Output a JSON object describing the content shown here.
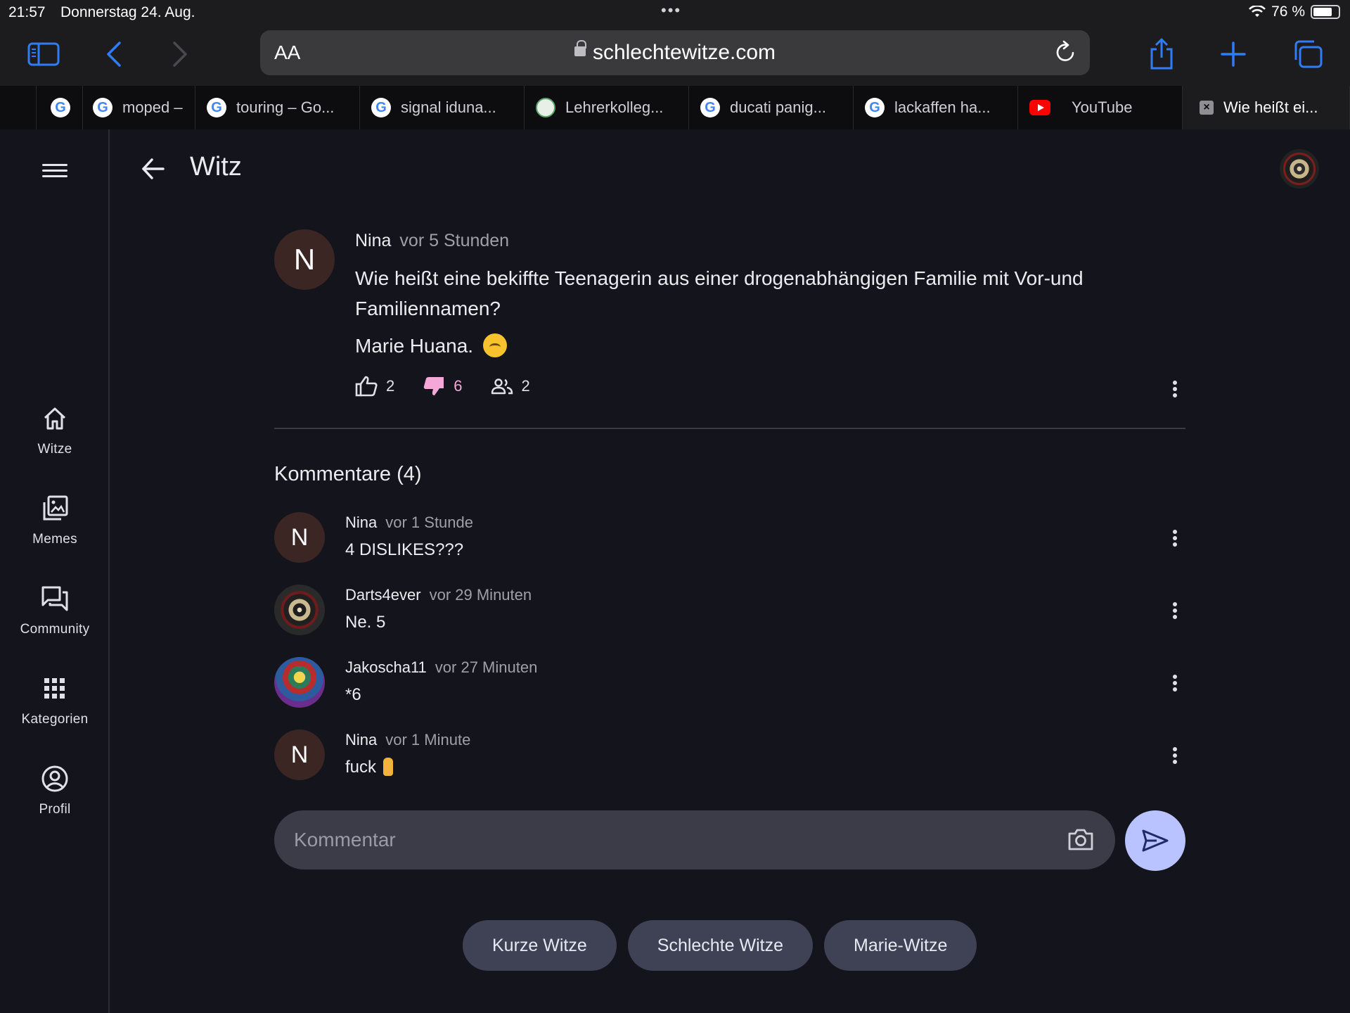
{
  "status_bar": {
    "time": "21:57",
    "date": "Donnerstag 24. Aug.",
    "battery": "76 %"
  },
  "browser": {
    "aa_label": "AA",
    "url": "schlechtewitze.com",
    "tabs": [
      {
        "label": "",
        "icon": "google-icon"
      },
      {
        "label": "moped –",
        "icon": "google-icon"
      },
      {
        "label": "touring – Go...",
        "icon": "google-icon"
      },
      {
        "label": "signal iduna...",
        "icon": "google-icon"
      },
      {
        "label": "Lehrerkolleg...",
        "icon": "moodle-icon"
      },
      {
        "label": "ducati panig...",
        "icon": "google-icon"
      },
      {
        "label": "lackaffen ha...",
        "icon": "google-icon"
      },
      {
        "label": "YouTube",
        "icon": "youtube-icon"
      },
      {
        "label": "Wie heißt ei...",
        "icon": "close-icon",
        "active": true
      }
    ]
  },
  "nav": {
    "items": [
      {
        "label": "Witze",
        "icon": "home-icon"
      },
      {
        "label": "Memes",
        "icon": "gallery-icon"
      },
      {
        "label": "Community",
        "icon": "forum-icon"
      },
      {
        "label": "Kategorien",
        "icon": "apps-icon"
      },
      {
        "label": "Profil",
        "icon": "profile-icon"
      }
    ]
  },
  "page": {
    "title": "Witz"
  },
  "post": {
    "avatar_letter": "N",
    "author": "Nina",
    "time": "vor 5 Stunden",
    "text_line1": "Wie heißt eine bekiffte Teenagerin aus einer drogenabhängigen Familie mit Vor-und Familiennamen?",
    "text_line2": "Marie Huana.",
    "likes": "2",
    "dislikes": "6",
    "participants": "2"
  },
  "comments": {
    "title": "Kommentare (4)",
    "items": [
      {
        "avatar": "N",
        "author": "Nina",
        "time": "vor 1 Stunde",
        "text": "4 DISLIKES???"
      },
      {
        "avatar": "",
        "author": "Darts4ever",
        "time": "vor 29 Minuten",
        "text": "Ne. 5"
      },
      {
        "avatar": "",
        "author": "Jakoscha11",
        "time": "vor 27 Minuten",
        "text": "*6"
      },
      {
        "avatar": "N",
        "author": "Nina",
        "time": "vor 1 Minute",
        "text": "fuck"
      }
    ]
  },
  "comment_input": {
    "placeholder": "Kommentar"
  },
  "chips": [
    "Kurze Witze",
    "Schlechte Witze",
    "Marie-Witze"
  ],
  "colors": {
    "background": "#14151c",
    "accent": "#b9c3ff",
    "dislike": "#f5a8d8",
    "chip": "#3e4254"
  }
}
